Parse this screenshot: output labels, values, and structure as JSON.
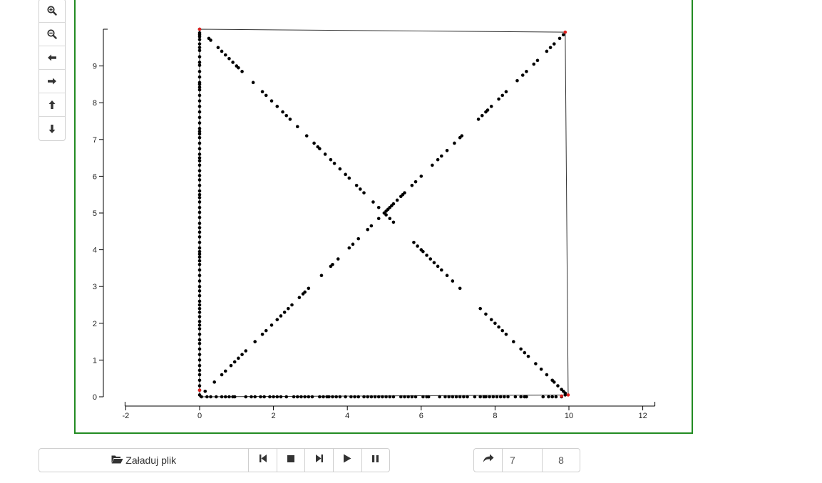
{
  "toolbar": {
    "buttons": [
      {
        "icon": "zoom-in-icon"
      },
      {
        "icon": "zoom-out-icon"
      },
      {
        "icon": "arrow-left-icon"
      },
      {
        "icon": "arrow-right-icon"
      },
      {
        "icon": "arrow-up-icon"
      },
      {
        "icon": "arrow-down-icon"
      }
    ]
  },
  "colors": {
    "frame_border": "#228B22",
    "point": "#000000",
    "highlight_point": "#e0201e",
    "outline": "#333333"
  },
  "controls": {
    "load_label": "Załaduj plik",
    "buttons": [
      "step-backward-icon",
      "stop-icon",
      "step-forward-icon",
      "play-icon",
      "pause-icon"
    ]
  },
  "stepper": {
    "value": "7",
    "total": "8",
    "icon": "share-icon"
  },
  "chart_data": {
    "type": "scatter",
    "xlim": [
      -2,
      12
    ],
    "ylim": [
      0,
      10
    ],
    "x_ticks": [
      -2,
      0,
      2,
      4,
      6,
      8,
      10,
      12
    ],
    "y_ticks": [
      0,
      1,
      2,
      3,
      4,
      5,
      6,
      7,
      8,
      9
    ],
    "grid": false,
    "outline": [
      [
        0,
        10
      ],
      [
        9.9,
        9.92
      ],
      [
        9.98,
        0.05
      ],
      [
        0,
        0
      ],
      [
        0,
        10
      ]
    ],
    "highlighted_points": [
      [
        0,
        10
      ],
      [
        9.9,
        9.92
      ],
      [
        9.98,
        0.05
      ],
      [
        0,
        0.18
      ],
      [
        9.8,
        0.02
      ]
    ],
    "series": [
      {
        "values": [
          [
            0,
            10
          ],
          [
            0,
            9.9
          ],
          [
            0,
            9.85
          ],
          [
            0,
            9.8
          ],
          [
            0,
            9.72
          ],
          [
            0,
            9.6
          ],
          [
            0,
            9.5
          ],
          [
            0,
            9.42
          ],
          [
            0,
            9.25
          ],
          [
            0,
            9.1
          ],
          [
            0,
            9.02
          ],
          [
            0,
            8.85
          ],
          [
            0,
            8.7
          ],
          [
            0,
            8.55
          ],
          [
            0,
            8.5
          ],
          [
            0,
            8.42
          ],
          [
            0,
            8.35
          ],
          [
            0,
            8.2
          ],
          [
            0,
            8.05
          ],
          [
            0,
            7.9
          ],
          [
            0,
            7.75
          ],
          [
            0,
            7.6
          ],
          [
            0,
            7.45
          ],
          [
            0,
            7.3
          ],
          [
            0,
            7.22
          ],
          [
            0,
            7.15
          ],
          [
            0,
            7.05
          ],
          [
            0,
            6.9
          ],
          [
            0,
            6.75
          ],
          [
            0,
            6.6
          ],
          [
            0,
            6.5
          ],
          [
            0,
            6.42
          ],
          [
            0,
            6.3
          ],
          [
            0,
            6.15
          ],
          [
            0,
            6.02
          ],
          [
            0,
            5.9
          ],
          [
            0,
            5.75
          ],
          [
            0,
            5.6
          ],
          [
            0,
            5.5
          ],
          [
            0,
            5.42
          ],
          [
            0,
            5.3
          ],
          [
            0,
            5.15
          ],
          [
            0,
            5.02
          ],
          [
            0,
            4.88
          ],
          [
            0,
            4.72
          ],
          [
            0,
            4.6
          ],
          [
            0,
            4.48
          ],
          [
            0,
            4.35
          ],
          [
            0,
            4.2
          ],
          [
            0,
            4.05
          ],
          [
            0,
            3.95
          ],
          [
            0,
            3.88
          ],
          [
            0,
            3.8
          ],
          [
            0,
            3.7
          ],
          [
            0,
            3.6
          ],
          [
            0,
            3.45
          ],
          [
            0,
            3.3
          ],
          [
            0,
            3.15
          ],
          [
            0,
            3.0
          ],
          [
            0,
            2.88
          ],
          [
            0,
            2.75
          ],
          [
            0,
            2.6
          ],
          [
            0,
            2.5
          ],
          [
            0,
            2.4
          ],
          [
            0,
            2.3
          ],
          [
            0,
            2.18
          ],
          [
            0,
            2.05
          ],
          [
            0,
            1.95
          ],
          [
            0,
            1.85
          ],
          [
            0,
            1.7
          ],
          [
            0,
            1.55
          ],
          [
            0,
            1.45
          ],
          [
            0,
            1.3
          ],
          [
            0,
            1.15
          ],
          [
            0,
            1.0
          ],
          [
            0,
            0.85
          ],
          [
            0,
            0.72
          ],
          [
            0,
            0.6
          ],
          [
            0,
            0.45
          ],
          [
            0,
            0.3
          ],
          [
            0,
            0.18
          ],
          [
            0,
            0.05
          ],
          [
            0.05,
            0
          ],
          [
            0.2,
            0
          ],
          [
            0.3,
            0
          ],
          [
            0.45,
            0
          ],
          [
            0.6,
            0
          ],
          [
            0.7,
            0
          ],
          [
            0.8,
            0
          ],
          [
            0.9,
            0
          ],
          [
            0.95,
            0
          ],
          [
            1.25,
            0
          ],
          [
            1.4,
            0
          ],
          [
            1.5,
            0
          ],
          [
            1.65,
            0
          ],
          [
            1.75,
            0
          ],
          [
            1.9,
            0
          ],
          [
            2.0,
            0
          ],
          [
            2.1,
            0
          ],
          [
            2.2,
            0
          ],
          [
            2.35,
            0
          ],
          [
            2.55,
            0
          ],
          [
            2.65,
            0
          ],
          [
            2.75,
            0
          ],
          [
            2.85,
            0
          ],
          [
            2.95,
            0
          ],
          [
            3.05,
            0
          ],
          [
            3.25,
            0
          ],
          [
            3.35,
            0
          ],
          [
            3.45,
            0
          ],
          [
            3.5,
            0
          ],
          [
            3.6,
            0
          ],
          [
            3.7,
            0
          ],
          [
            3.8,
            0
          ],
          [
            3.95,
            0
          ],
          [
            4.1,
            0
          ],
          [
            4.2,
            0
          ],
          [
            4.3,
            0
          ],
          [
            4.45,
            0
          ],
          [
            4.55,
            0
          ],
          [
            4.65,
            0
          ],
          [
            4.75,
            0
          ],
          [
            4.85,
            0
          ],
          [
            4.95,
            0
          ],
          [
            5.05,
            0
          ],
          [
            5.15,
            0
          ],
          [
            5.25,
            0
          ],
          [
            5.45,
            0
          ],
          [
            5.55,
            0
          ],
          [
            5.65,
            0
          ],
          [
            5.75,
            0
          ],
          [
            5.85,
            0
          ],
          [
            6.05,
            0
          ],
          [
            6.15,
            0
          ],
          [
            6.2,
            0
          ],
          [
            6.5,
            0
          ],
          [
            6.65,
            0
          ],
          [
            6.75,
            0
          ],
          [
            6.85,
            0
          ],
          [
            6.95,
            0
          ],
          [
            7.05,
            0
          ],
          [
            7.15,
            0
          ],
          [
            7.25,
            0
          ],
          [
            7.45,
            0
          ],
          [
            7.6,
            0
          ],
          [
            7.7,
            0
          ],
          [
            7.75,
            0
          ],
          [
            7.85,
            0
          ],
          [
            7.95,
            0
          ],
          [
            8.05,
            0
          ],
          [
            8.15,
            0
          ],
          [
            8.25,
            0
          ],
          [
            8.35,
            0
          ],
          [
            8.55,
            0
          ],
          [
            8.7,
            0
          ],
          [
            8.8,
            0
          ],
          [
            8.85,
            0
          ],
          [
            9.3,
            0
          ],
          [
            9.45,
            0
          ],
          [
            9.55,
            0
          ],
          [
            9.65,
            0
          ],
          [
            9.8,
            0
          ],
          [
            9.9,
            0.05
          ],
          [
            0.15,
            0.15
          ],
          [
            0.4,
            0.4
          ],
          [
            0.6,
            0.6
          ],
          [
            0.7,
            0.7
          ],
          [
            0.85,
            0.85
          ],
          [
            0.95,
            0.95
          ],
          [
            1.05,
            1.05
          ],
          [
            1.15,
            1.15
          ],
          [
            1.25,
            1.25
          ],
          [
            1.5,
            1.5
          ],
          [
            1.7,
            1.7
          ],
          [
            1.8,
            1.8
          ],
          [
            1.95,
            1.95
          ],
          [
            2.1,
            2.1
          ],
          [
            2.2,
            2.2
          ],
          [
            2.3,
            2.3
          ],
          [
            2.4,
            2.4
          ],
          [
            2.5,
            2.5
          ],
          [
            2.7,
            2.7
          ],
          [
            2.8,
            2.8
          ],
          [
            2.85,
            2.85
          ],
          [
            2.95,
            2.95
          ],
          [
            3.3,
            3.3
          ],
          [
            3.55,
            3.55
          ],
          [
            3.6,
            3.6
          ],
          [
            3.75,
            3.75
          ],
          [
            4.05,
            4.05
          ],
          [
            4.15,
            4.15
          ],
          [
            4.3,
            4.3
          ],
          [
            4.55,
            4.55
          ],
          [
            4.65,
            4.65
          ],
          [
            4.85,
            4.85
          ],
          [
            5.0,
            5.0
          ],
          [
            5.05,
            5.05
          ],
          [
            5.1,
            5.1
          ],
          [
            5.15,
            5.15
          ],
          [
            5.2,
            5.2
          ],
          [
            5.25,
            5.25
          ],
          [
            5.35,
            5.35
          ],
          [
            5.45,
            5.45
          ],
          [
            5.5,
            5.5
          ],
          [
            5.55,
            5.55
          ],
          [
            5.75,
            5.75
          ],
          [
            5.85,
            5.85
          ],
          [
            6.0,
            6.0
          ],
          [
            6.3,
            6.3
          ],
          [
            6.45,
            6.45
          ],
          [
            6.55,
            6.55
          ],
          [
            6.7,
            6.7
          ],
          [
            6.9,
            6.9
          ],
          [
            7.05,
            7.05
          ],
          [
            7.1,
            7.1
          ],
          [
            7.55,
            7.55
          ],
          [
            7.65,
            7.65
          ],
          [
            7.75,
            7.75
          ],
          [
            7.8,
            7.8
          ],
          [
            7.9,
            7.9
          ],
          [
            8.1,
            8.1
          ],
          [
            8.2,
            8.2
          ],
          [
            8.3,
            8.3
          ],
          [
            8.6,
            8.6
          ],
          [
            8.75,
            8.75
          ],
          [
            8.85,
            8.85
          ],
          [
            9.05,
            9.05
          ],
          [
            9.15,
            9.15
          ],
          [
            9.4,
            9.4
          ],
          [
            9.5,
            9.5
          ],
          [
            9.6,
            9.6
          ],
          [
            9.75,
            9.75
          ],
          [
            9.85,
            9.85
          ],
          [
            0.25,
            9.75
          ],
          [
            0.3,
            9.7
          ],
          [
            0.5,
            9.5
          ],
          [
            0.6,
            9.4
          ],
          [
            0.7,
            9.3
          ],
          [
            0.8,
            9.2
          ],
          [
            0.9,
            9.1
          ],
          [
            1.0,
            9.0
          ],
          [
            1.05,
            8.95
          ],
          [
            1.15,
            8.85
          ],
          [
            1.45,
            8.55
          ],
          [
            1.7,
            8.3
          ],
          [
            1.8,
            8.2
          ],
          [
            1.95,
            8.05
          ],
          [
            2.1,
            7.9
          ],
          [
            2.25,
            7.75
          ],
          [
            2.35,
            7.65
          ],
          [
            2.45,
            7.55
          ],
          [
            2.65,
            7.35
          ],
          [
            2.9,
            7.1
          ],
          [
            3.1,
            6.9
          ],
          [
            3.2,
            6.8
          ],
          [
            3.25,
            6.75
          ],
          [
            3.4,
            6.6
          ],
          [
            3.55,
            6.45
          ],
          [
            3.65,
            6.35
          ],
          [
            3.8,
            6.2
          ],
          [
            3.95,
            6.05
          ],
          [
            4.05,
            5.95
          ],
          [
            4.25,
            5.75
          ],
          [
            4.35,
            5.65
          ],
          [
            4.45,
            5.55
          ],
          [
            4.7,
            5.3
          ],
          [
            4.85,
            5.15
          ],
          [
            5.0,
            5.0
          ],
          [
            5.05,
            4.95
          ],
          [
            5.15,
            4.85
          ],
          [
            5.25,
            4.75
          ],
          [
            5.8,
            4.2
          ],
          [
            5.9,
            4.1
          ],
          [
            6.0,
            4.0
          ],
          [
            6.05,
            3.95
          ],
          [
            6.15,
            3.85
          ],
          [
            6.25,
            3.75
          ],
          [
            6.35,
            3.65
          ],
          [
            6.45,
            3.55
          ],
          [
            6.55,
            3.45
          ],
          [
            6.7,
            3.3
          ],
          [
            6.85,
            3.15
          ],
          [
            7.05,
            2.95
          ],
          [
            7.6,
            2.4
          ],
          [
            7.75,
            2.25
          ],
          [
            7.9,
            2.1
          ],
          [
            8.0,
            2.0
          ],
          [
            8.1,
            1.9
          ],
          [
            8.2,
            1.8
          ],
          [
            8.3,
            1.7
          ],
          [
            8.5,
            1.5
          ],
          [
            8.7,
            1.3
          ],
          [
            8.8,
            1.2
          ],
          [
            8.9,
            1.1
          ],
          [
            9.1,
            0.9
          ],
          [
            9.25,
            0.75
          ],
          [
            9.4,
            0.6
          ],
          [
            9.55,
            0.45
          ],
          [
            9.6,
            0.4
          ],
          [
            9.7,
            0.3
          ],
          [
            9.8,
            0.2
          ],
          [
            9.85,
            0.15
          ],
          [
            9.9,
            0.1
          ]
        ]
      }
    ]
  }
}
